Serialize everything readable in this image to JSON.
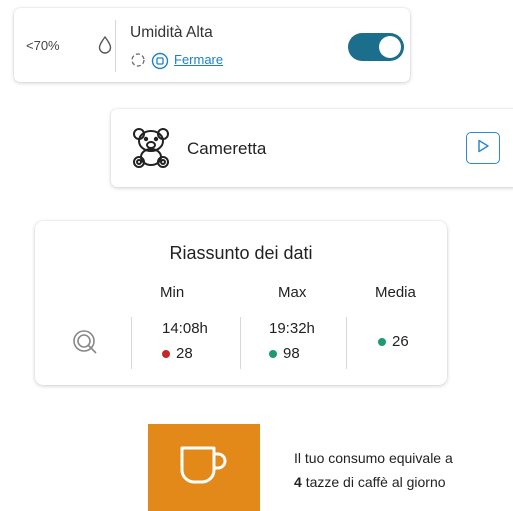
{
  "humidity_card": {
    "threshold": "<70%",
    "title": "Umidità Alta",
    "stop_label": "Fermare",
    "toggle_on": true,
    "toggle_color": "#1c6f8c"
  },
  "room_card": {
    "name": "Cameretta",
    "icons": [
      "teddy-bear-icon",
      "play-icon"
    ]
  },
  "summary_card": {
    "title": "Riassunto dei dati",
    "columns": [
      {
        "header": "Min",
        "time": "14:08h",
        "value": "28",
        "dot_color": "#c62828"
      },
      {
        "header": "Max",
        "time": "19:32h",
        "value": "98",
        "dot_color": "#1e9a6e"
      },
      {
        "header": "Media",
        "time": "",
        "value": "26",
        "dot_color": "#1e9a6e"
      }
    ]
  },
  "coffee_card": {
    "line1": "Il tuo consumo equivale a",
    "count": "4",
    "line2_rest": "tazze di caffè al giorno",
    "accent_color": "#e3891a"
  }
}
